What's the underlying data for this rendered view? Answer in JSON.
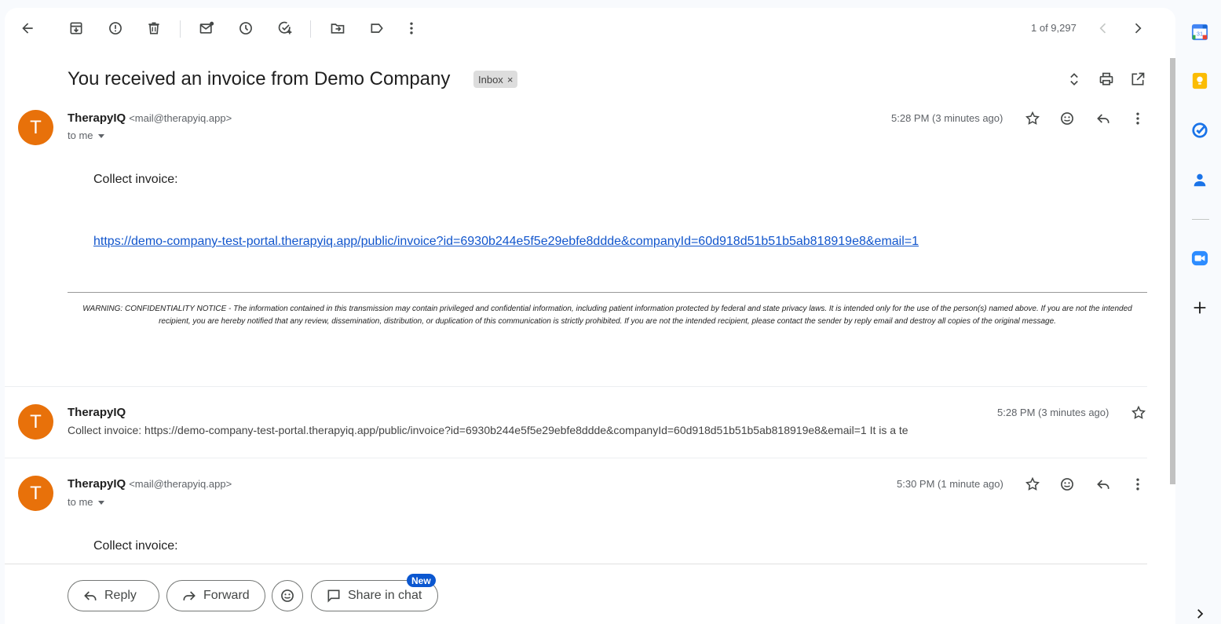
{
  "toolbar": {
    "pager": "1 of 9,297"
  },
  "email": {
    "subject": "You received an invoice from Demo Company",
    "label_chip": "Inbox",
    "messages": [
      {
        "avatar_letter": "T",
        "sender": "TherapyIQ",
        "sender_email": "<mail@therapyiq.app>",
        "to": "to me",
        "time": "5:28 PM (3 minutes ago)",
        "body_intro": "Collect invoice:",
        "link": "https://demo-company-test-portal.therapyiq.app/public/invoice?id=6930b244e5f5e29ebfe8ddde&companyId=60d918d51b51b5ab818919e8&email=1",
        "notice": "WARNING: CONFIDENTIALITY NOTICE - The information contained in this transmission may contain privileged and confidential information, including patient information protected by federal and state privacy laws. It is intended only for the use of the person(s) named above. If you are not the intended recipient, you are hereby notified that any review, dissemination, distribution, or duplication of this communication is strictly prohibited. If you are not the intended recipient, please contact the sender by reply email and destroy all copies of the original message."
      },
      {
        "avatar_letter": "T",
        "sender": "TherapyIQ",
        "time": "5:28 PM (3 minutes ago)",
        "snippet": "Collect invoice: https://demo-company-test-portal.therapyiq.app/public/invoice?id=6930b244e5f5e29ebfe8ddde&companyId=60d918d51b51b5ab818919e8&email=1 It is a te"
      },
      {
        "avatar_letter": "T",
        "sender": "TherapyIQ",
        "sender_email": "<mail@therapyiq.app>",
        "to": "to me",
        "time": "5:30 PM (1 minute ago)",
        "body_intro": "Collect invoice:"
      }
    ]
  },
  "actions": {
    "reply": "Reply",
    "forward": "Forward",
    "share_in_chat": "Share in chat",
    "new_badge": "New"
  },
  "sidebar": {
    "calendar_day": "31"
  },
  "colors": {
    "avatar": "#e8710a",
    "link": "#1155cc",
    "badge": "#0b57d0"
  }
}
